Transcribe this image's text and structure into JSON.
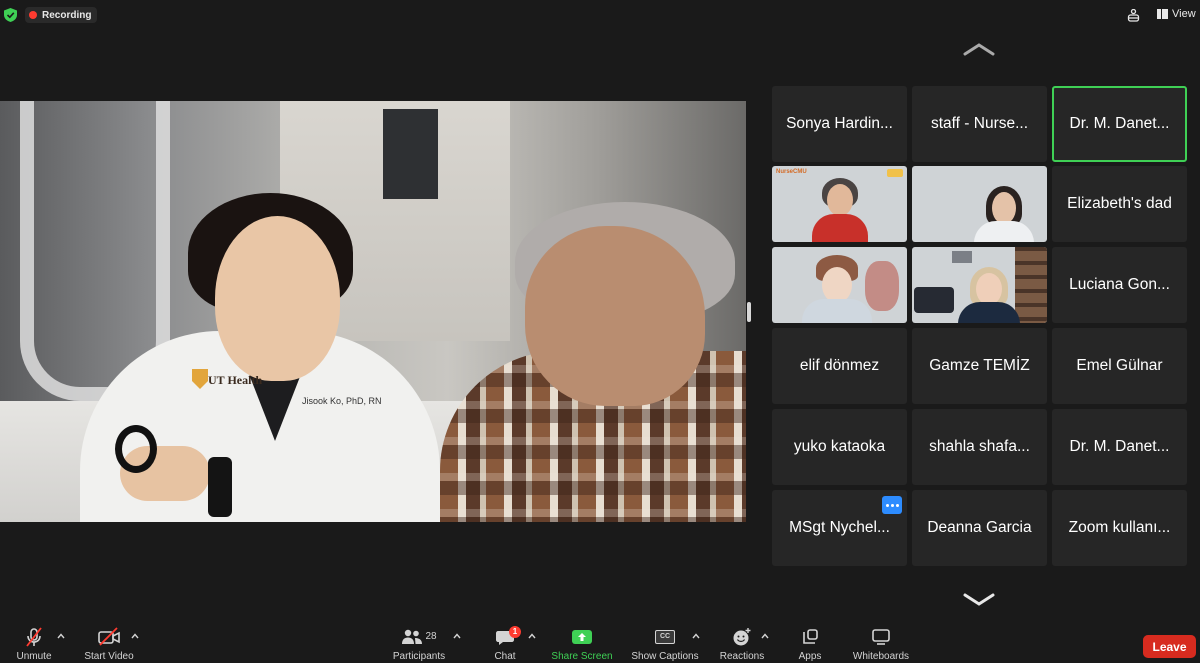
{
  "topbar": {
    "recording_label": "Recording",
    "view_label": "View",
    "icons": [
      "shield-check-icon",
      "recording-dot-icon",
      "accessibility-icon",
      "view-grid-icon"
    ]
  },
  "main_video": {
    "slide_logo_text": "UT Health",
    "coat_name_text": "Jisook Ko, PhD, RN"
  },
  "gallery": {
    "tiles": [
      {
        "name": "Sonya Hardin...",
        "type": "name",
        "active": false
      },
      {
        "name": "staff - Nurse...",
        "type": "name",
        "active": false
      },
      {
        "name": "Dr. M. Danet...",
        "type": "name",
        "active": true
      },
      {
        "name": "",
        "type": "video",
        "active": false
      },
      {
        "name": "",
        "type": "video",
        "active": false
      },
      {
        "name": "Elizabeth's dad",
        "type": "name",
        "active": false
      },
      {
        "name": "",
        "type": "video",
        "active": false
      },
      {
        "name": "",
        "type": "video",
        "active": false
      },
      {
        "name": "Luciana Gon...",
        "type": "name",
        "active": false
      },
      {
        "name": "elif dönmez",
        "type": "name",
        "active": false
      },
      {
        "name": "Gamze TEMİZ",
        "type": "name",
        "active": false
      },
      {
        "name": "Emel Gülnar",
        "type": "name",
        "active": false
      },
      {
        "name": "yuko kataoka",
        "type": "name",
        "active": false
      },
      {
        "name": "shahla shafa...",
        "type": "name",
        "active": false
      },
      {
        "name": "Dr. M. Danet...",
        "type": "name",
        "active": false
      },
      {
        "name": "MSgt Nychel...",
        "type": "name",
        "active": false
      },
      {
        "name": "Deanna Garcia",
        "type": "name",
        "active": false
      },
      {
        "name": "Zoom kullanı...",
        "type": "name",
        "active": false
      }
    ],
    "thumb_brand": "NurseCMU"
  },
  "toolbar": {
    "unmute": "Unmute",
    "start_video": "Start Video",
    "participants": "Participants",
    "participants_count": "28",
    "chat": "Chat",
    "chat_badge": "1",
    "share_screen": "Share Screen",
    "show_captions": "Show Captions",
    "cc_text": "CC",
    "reactions": "Reactions",
    "apps": "Apps",
    "whiteboards": "Whiteboards",
    "leave": "Leave"
  },
  "colors": {
    "accent_green": "#3fd055",
    "leave_red": "#d72b1f",
    "record_red": "#ff3b30",
    "tile_bg": "#262626",
    "more_blue": "#2d8cff"
  }
}
